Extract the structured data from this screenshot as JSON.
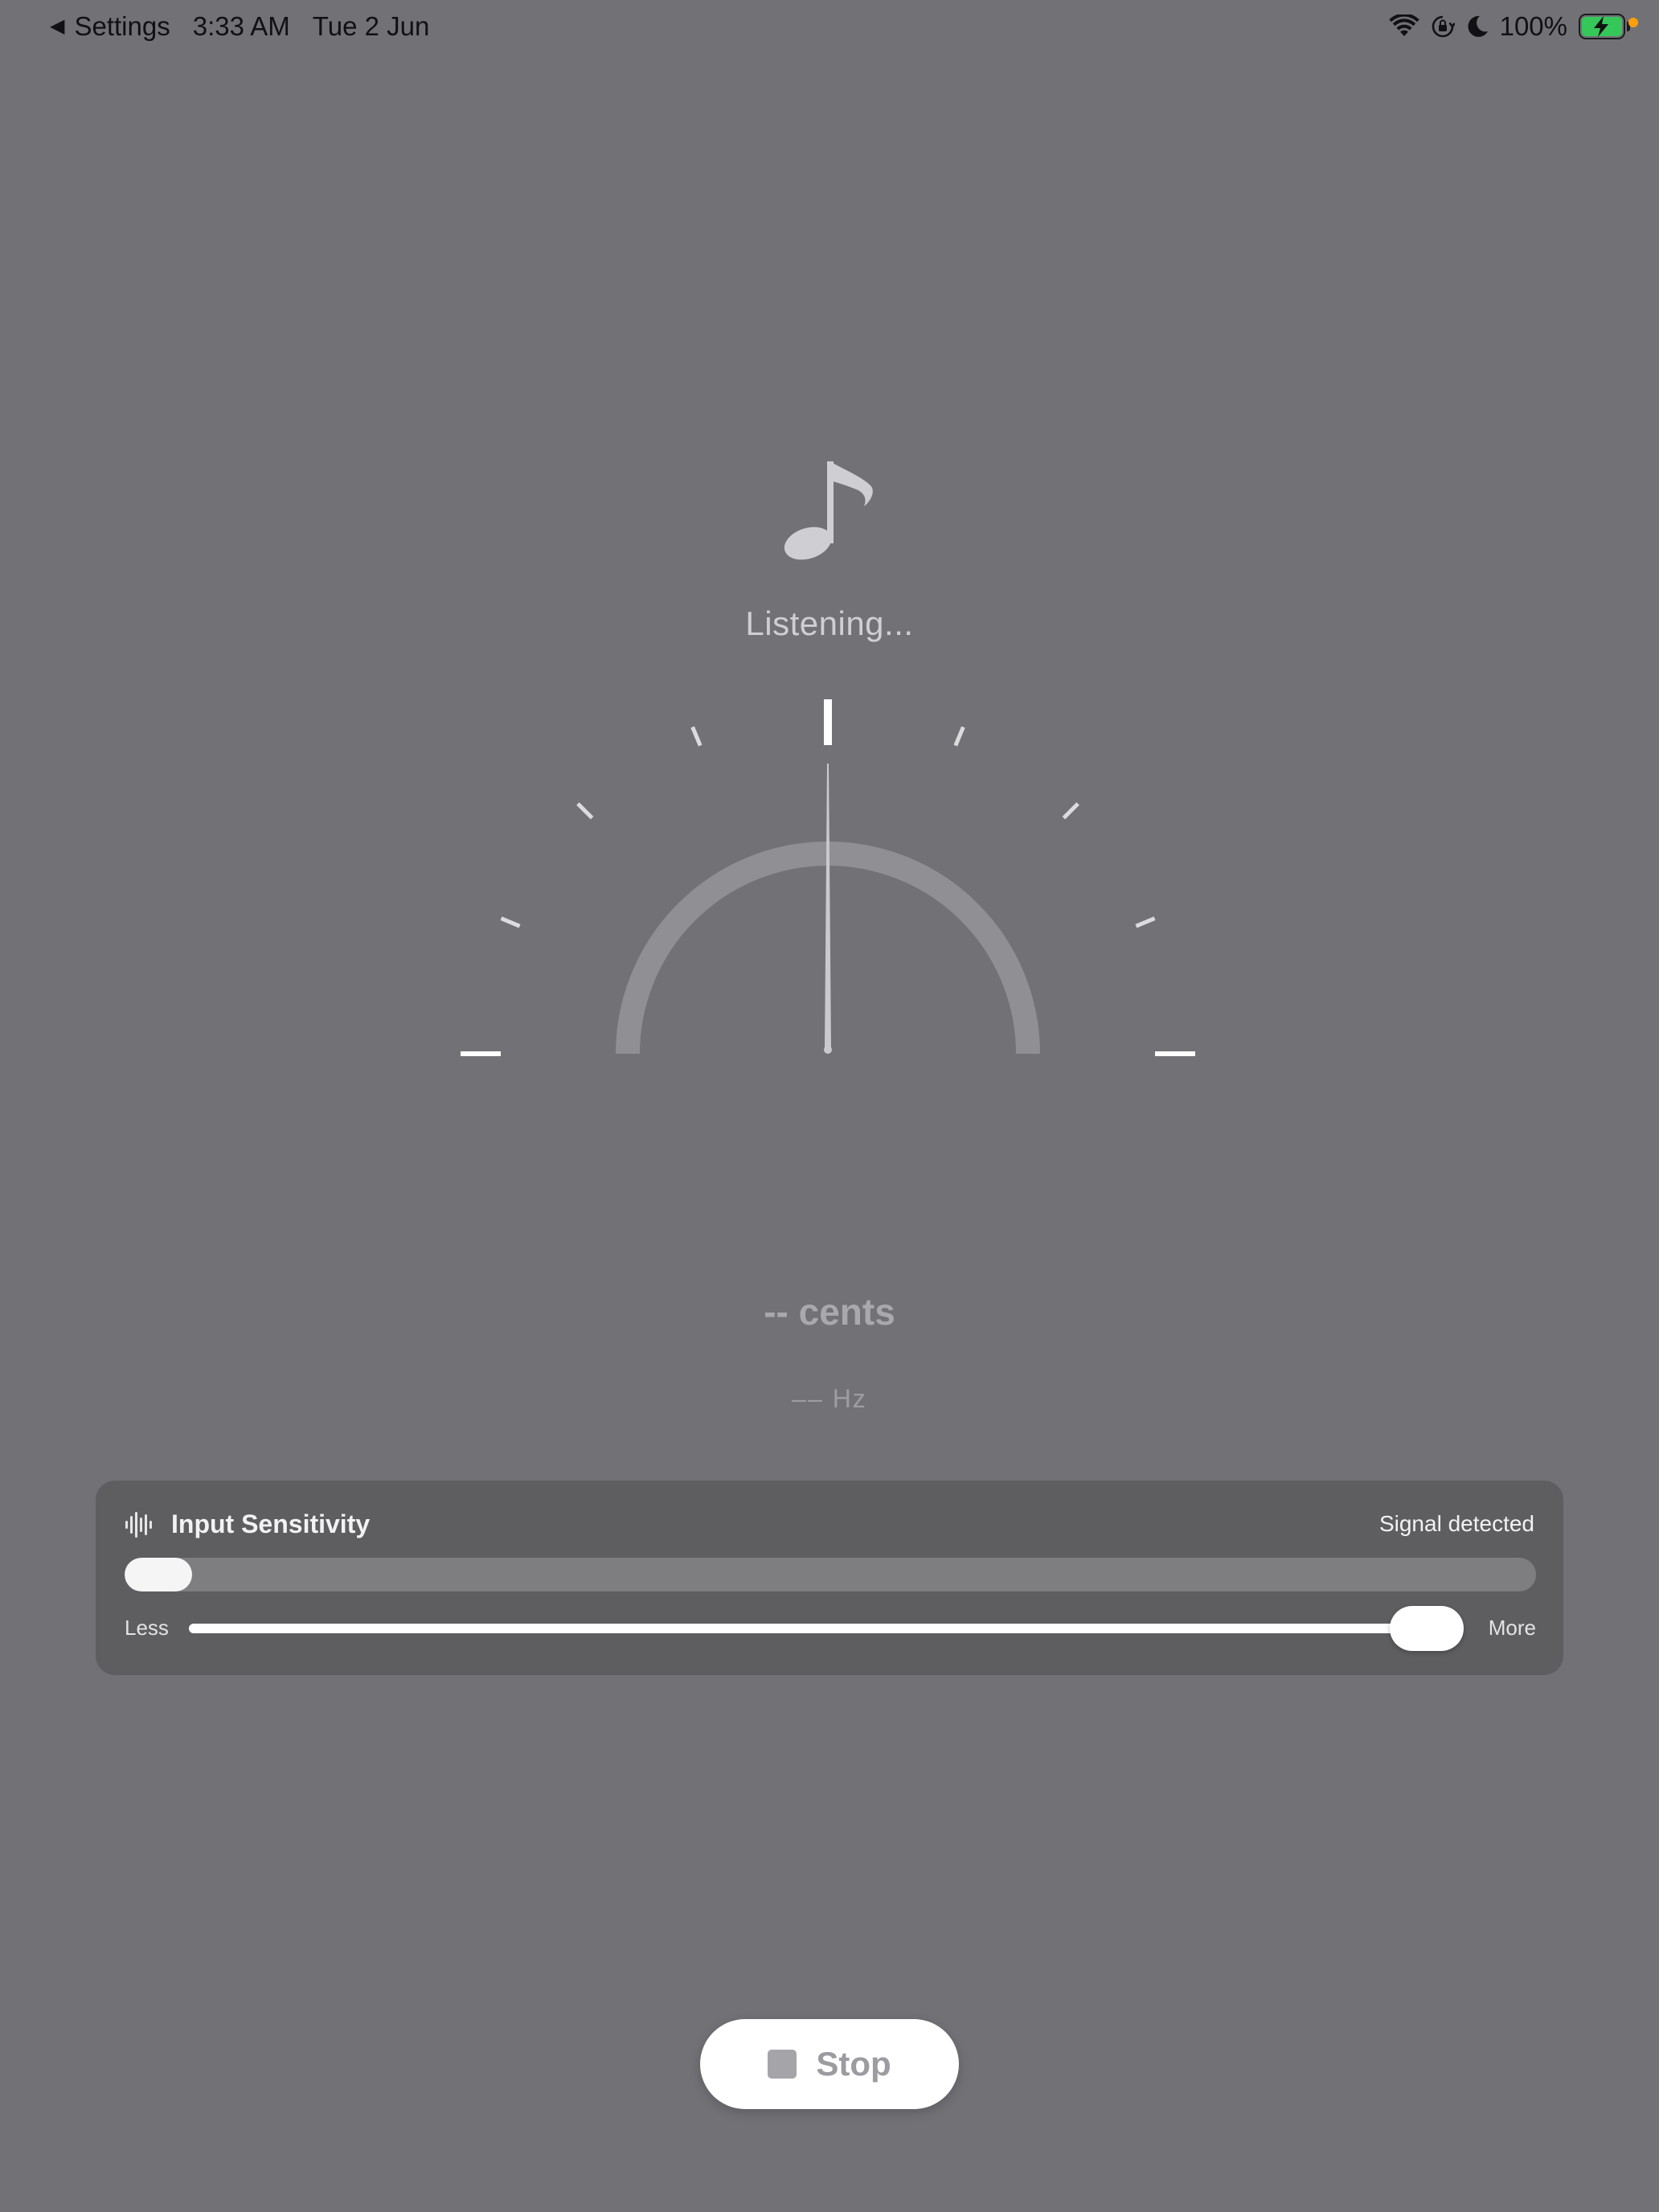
{
  "status_bar": {
    "back_label": "Settings",
    "time": "3:33 AM",
    "date": "Tue 2 Jun",
    "battery_percent": "100%",
    "battery_level": 1.0,
    "charging": true,
    "icons": [
      "wifi-icon",
      "orientation-lock-icon",
      "moon-icon",
      "battery-charging-icon"
    ],
    "colors": {
      "battery_fill": "#35c759",
      "privacy_dot": "#ff9f0a"
    }
  },
  "tuner": {
    "icon": "music-note-icon",
    "status": "Listening...",
    "cents_readout": "-- cents",
    "hz_readout": "–– Hz",
    "needle_cents": 0,
    "scale_min_cents": -50,
    "scale_max_cents": 50
  },
  "sensitivity": {
    "icon": "waveform-icon",
    "title": "Input Sensitivity",
    "signal_status": "Signal detected",
    "input_level": 0.03,
    "slider_value": 1.0,
    "less_label": "Less",
    "more_label": "More"
  },
  "controls": {
    "stop_label": "Stop",
    "stop_icon": "stop-square-icon"
  },
  "colors": {
    "background": "#727176",
    "card": "#5e5e61",
    "accent_white": "#ffffff"
  }
}
